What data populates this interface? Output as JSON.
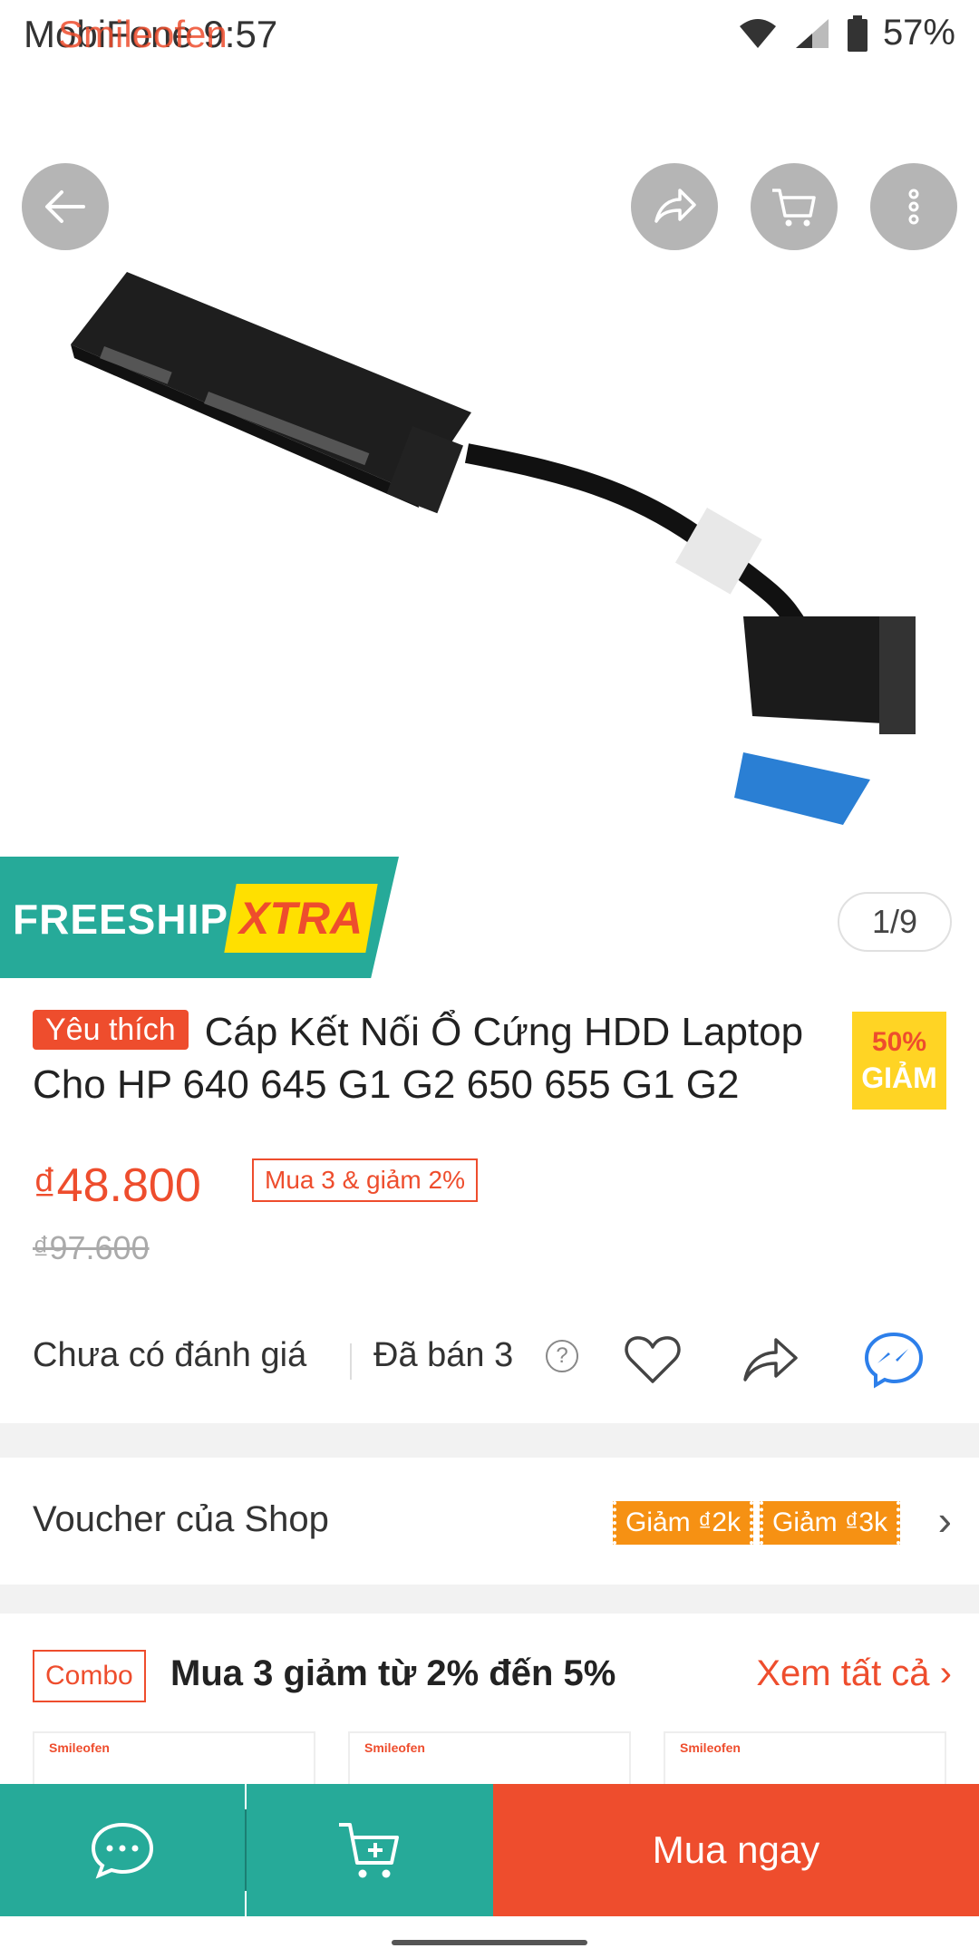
{
  "status_bar": {
    "carrier": "MobiFone 9:57",
    "overlay_text": "Smileofen",
    "battery": "57%"
  },
  "gallery": {
    "counter": "1/9",
    "icons": [
      "back-arrow-icon",
      "share-icon",
      "cart-icon",
      "more-vertical-icon"
    ]
  },
  "freeship": {
    "label": "FREESHIP",
    "xtra": "XTRA"
  },
  "product": {
    "badge": "Yêu thích",
    "title": "Cáp Kết Nối Ổ Cứng HDD Laptop Cho HP 640 645 G1 G2 650 655 G1 G2",
    "discount_pct": "50%",
    "discount_label": "GIẢM",
    "price": "₫48.800",
    "promo": "Mua 3 & giảm 2%",
    "old_price": "₫97.600"
  },
  "stats": {
    "rating": "Chưa có đánh giá",
    "sold": "Đã bán 3",
    "help": "?"
  },
  "voucher": {
    "label": "Voucher của Shop",
    "chips": [
      "Giảm ₫2k",
      "Giảm ₫3k"
    ]
  },
  "combo": {
    "tag": "Combo",
    "text": "Mua 3 giảm từ 2% đến 5%",
    "see_all": "Xem tất cả",
    "thumb_brand": "Smileofen"
  },
  "bottom_bar": {
    "buy_now": "Mua ngay"
  },
  "colors": {
    "accent": "#ee4d2d",
    "teal": "#26aa99",
    "yellow": "#ffd424"
  }
}
